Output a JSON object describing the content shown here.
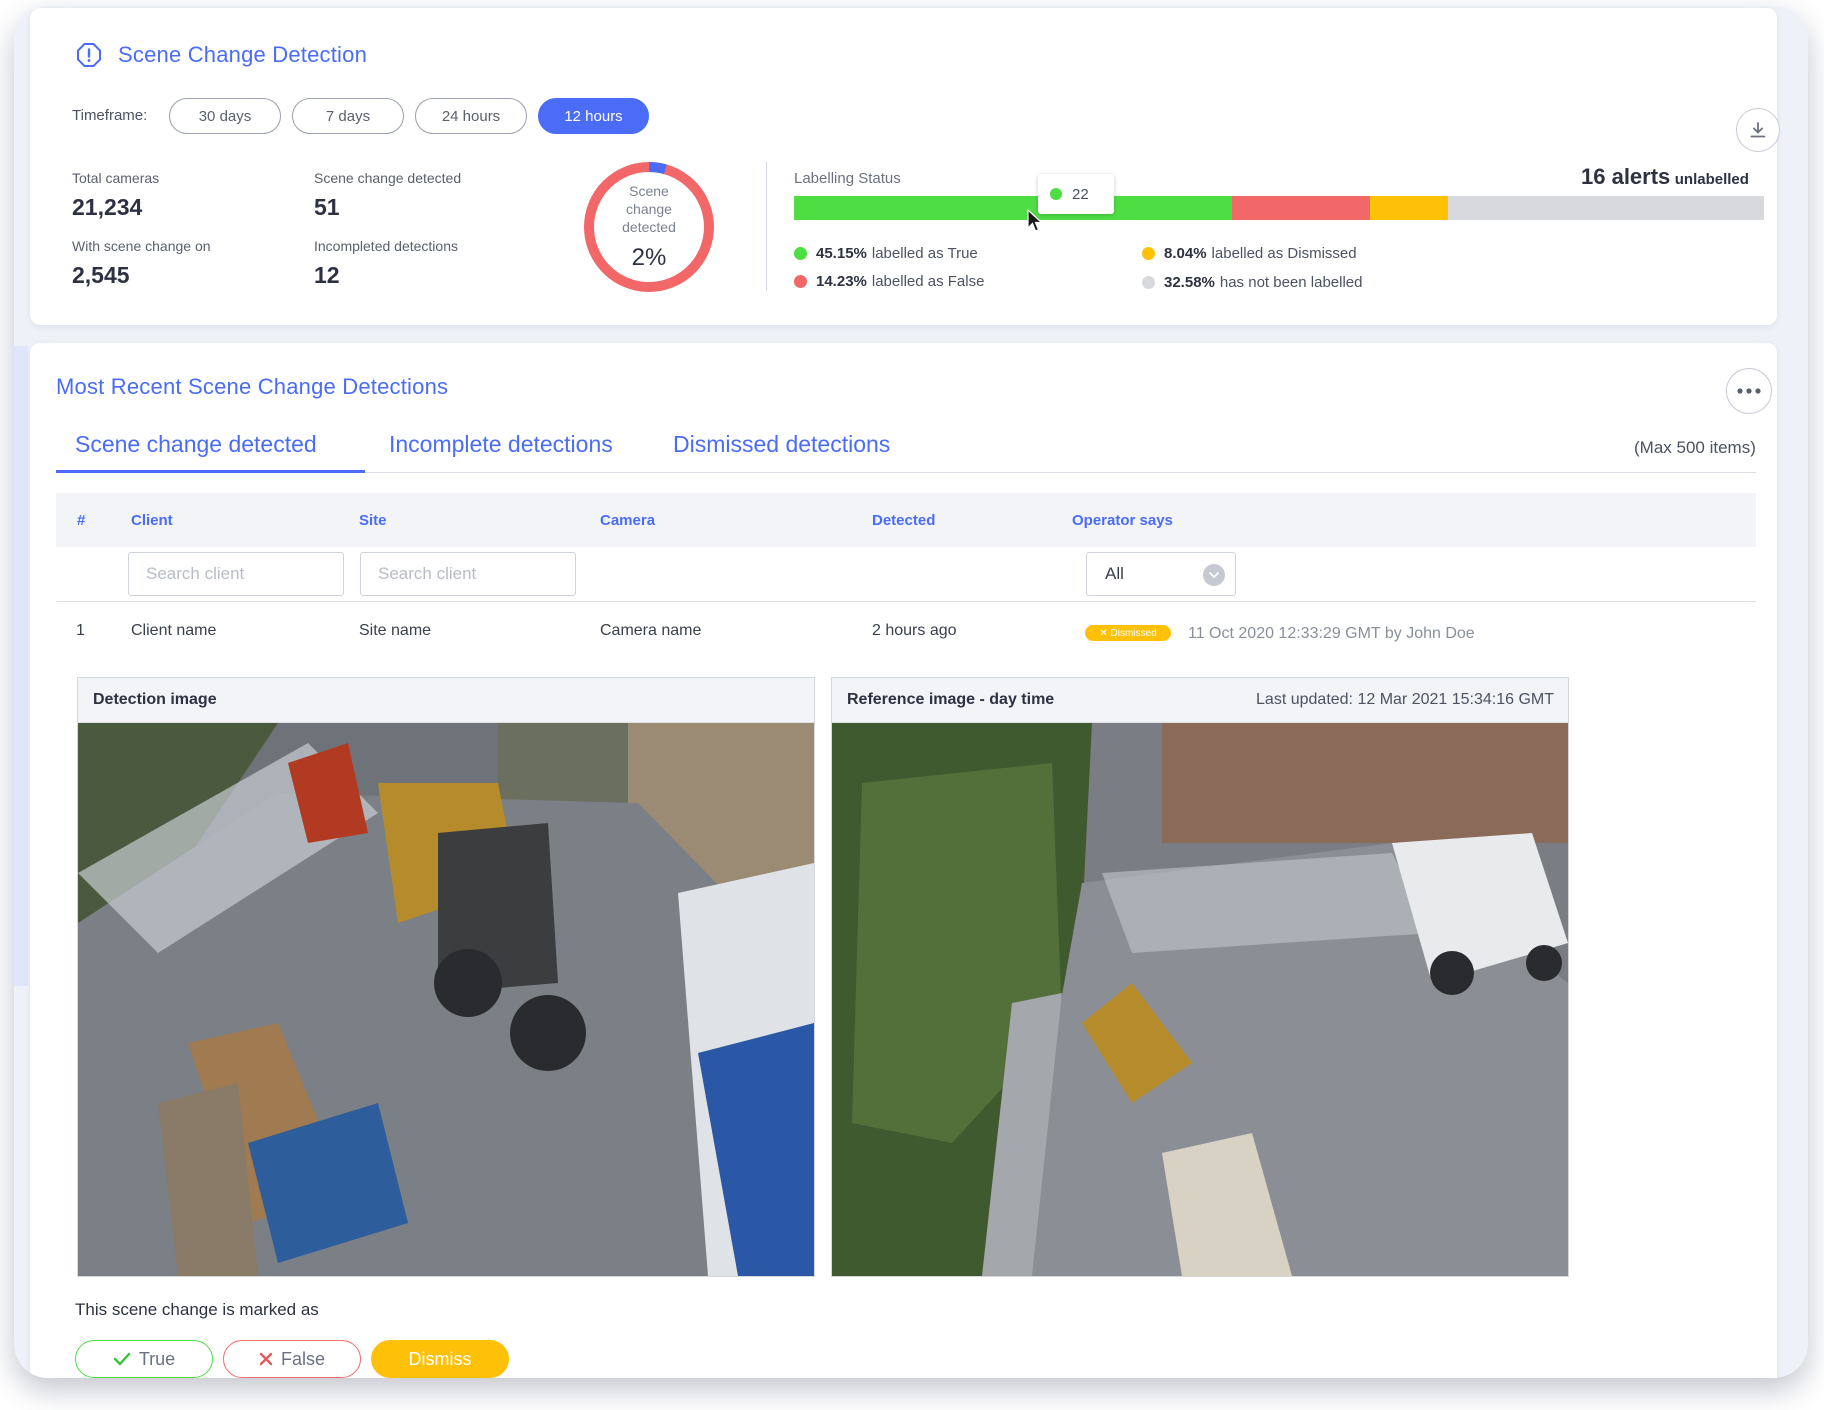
{
  "header": {
    "title": "Scene Change Detection",
    "timeframe_label": "Timeframe:",
    "timeframes": [
      "30 days",
      "7 days",
      "24 hours",
      "12 hours"
    ],
    "active_timeframe": "12 hours"
  },
  "stats": {
    "total_cameras_label": "Total cameras",
    "total_cameras": "21,234",
    "scene_change_label": "Scene change detected",
    "scene_change": "51",
    "with_scene_change_label": "With scene change on",
    "with_scene_change": "2,545",
    "incompleted_label": "Incompleted detections",
    "incompleted": "12"
  },
  "donut": {
    "label_line1": "Scene",
    "label_line2": "change",
    "label_line3": "detected",
    "percent_text": "2%",
    "percent": 2,
    "track_color": "#f26868",
    "value_color": "#4a6cf7"
  },
  "labelling": {
    "title": "Labelling Status",
    "alerts_count": "16 alerts",
    "alerts_suffix": "unlabelled",
    "tooltip_value": "22",
    "segments": [
      {
        "pct_text": "45.15%",
        "pct": 45.15,
        "label": "labelled as True",
        "color": "#4ede44"
      },
      {
        "pct_text": "14.23%",
        "pct": 14.23,
        "label": "labelled as False",
        "color": "#f26868"
      },
      {
        "pct_text": "8.04%",
        "pct": 8.04,
        "label": "labelled as Dismissed",
        "color": "#ffc107"
      },
      {
        "pct_text": "32.58%",
        "pct": 32.58,
        "label": "has not been labelled",
        "color": "#d8d9dd"
      }
    ]
  },
  "recent": {
    "title": "Most Recent Scene Change Detections",
    "tabs": [
      "Scene change detected",
      "Incomplete detections",
      "Dismissed detections"
    ],
    "active_tab": "Scene change detected",
    "max_items": "(Max 500 items)",
    "columns": [
      "#",
      "Client",
      "Site",
      "Camera",
      "Detected",
      "Operator says"
    ],
    "search_client_placeholder": "Search client",
    "search_site_placeholder": "Search client",
    "operator_filter": "All",
    "rows": [
      {
        "index": "1",
        "client": "Client name",
        "site": "Site name",
        "camera": "Camera name",
        "detected": "2 hours ago",
        "badge": "✕ Dismissed",
        "operator_meta": "11 Oct 2020 12:33:29 GMT by John Doe"
      }
    ]
  },
  "detail": {
    "detection_title": "Detection image",
    "reference_title": "Reference image - day time",
    "reference_updated": "Last updated: 12 Mar 2021 15:34:16 GMT",
    "marked_as_label": "This scene change is marked as",
    "true_label": "True",
    "false_label": "False",
    "dismiss_label": "Dismiss"
  },
  "icons": {
    "title_icon": "alert-octagon-icon",
    "download": "download-icon",
    "more": "more-horizontal-icon",
    "select_chevron": "chevron-down-icon",
    "true_icon": "check-icon",
    "false_icon": "x-icon"
  }
}
